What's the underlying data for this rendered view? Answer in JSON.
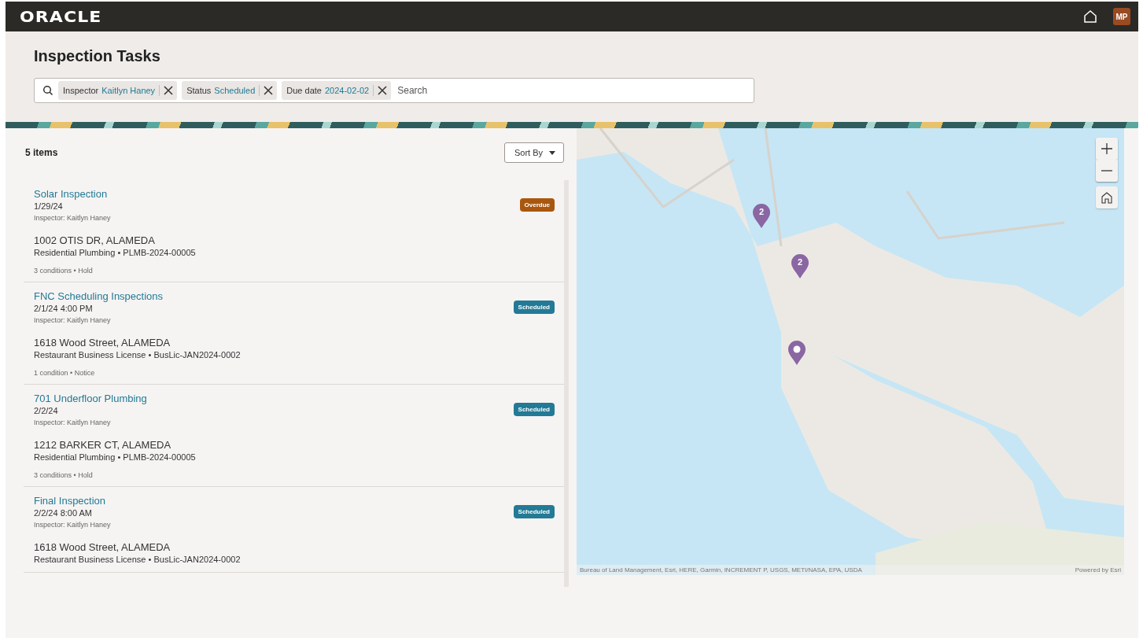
{
  "header": {
    "logo": "ORACLE",
    "avatar": "MP"
  },
  "page": {
    "title": "Inspection Tasks"
  },
  "filters": [
    {
      "label": "Inspector",
      "value": "Kaitlyn Haney"
    },
    {
      "label": "Status",
      "value": "Scheduled"
    },
    {
      "label": "Due date",
      "value": "2024-02-02"
    }
  ],
  "search": {
    "placeholder": "Search"
  },
  "list": {
    "count": "5 items",
    "sort_label": "Sort By"
  },
  "tasks": [
    {
      "title": "Solar Inspection",
      "date": "1/29/24",
      "inspector": "Inspector: Kaitlyn Haney",
      "address": "1002 OTIS DR, ALAMEDA",
      "record": "Residential Plumbing • PLMB-2024-00005",
      "conditions": "3 conditions • Hold",
      "status": {
        "label": "Overdue",
        "kind": "overdue"
      }
    },
    {
      "title": "FNC Scheduling Inspections",
      "date": "2/1/24 4:00 PM",
      "inspector": "Inspector: Kaitlyn Haney",
      "address": "1618 Wood Street, ALAMEDA",
      "record": "Restaurant Business License • BusLic-JAN2024-0002",
      "conditions": "1 condition • Notice",
      "status": {
        "label": "Scheduled",
        "kind": "scheduled"
      }
    },
    {
      "title": "701 Underfloor Plumbing",
      "date": "2/2/24",
      "inspector": "Inspector: Kaitlyn Haney",
      "address": "1212 BARKER CT, ALAMEDA",
      "record": "Residential Plumbing • PLMB-2024-00005",
      "conditions": "3 conditions • Hold",
      "status": {
        "label": "Scheduled",
        "kind": "scheduled"
      }
    },
    {
      "title": "Final Inspection",
      "date": "2/2/24 8:00 AM",
      "inspector": "Inspector: Kaitlyn Haney",
      "address": "1618 Wood Street, ALAMEDA",
      "record": "Restaurant Business License • BusLic-JAN2024-0002",
      "status": {
        "label": "Scheduled",
        "kind": "scheduled"
      }
    }
  ],
  "map": {
    "markers": [
      {
        "kind": "cluster",
        "count": "2"
      },
      {
        "kind": "cluster",
        "count": "2"
      },
      {
        "kind": "single"
      }
    ],
    "attribution": "Bureau of Land Management, Esri, HERE, Garmin, INCREMENT P, USGS, METI/NASA, EPA, USDA",
    "powered_by": "Powered by Esri"
  }
}
